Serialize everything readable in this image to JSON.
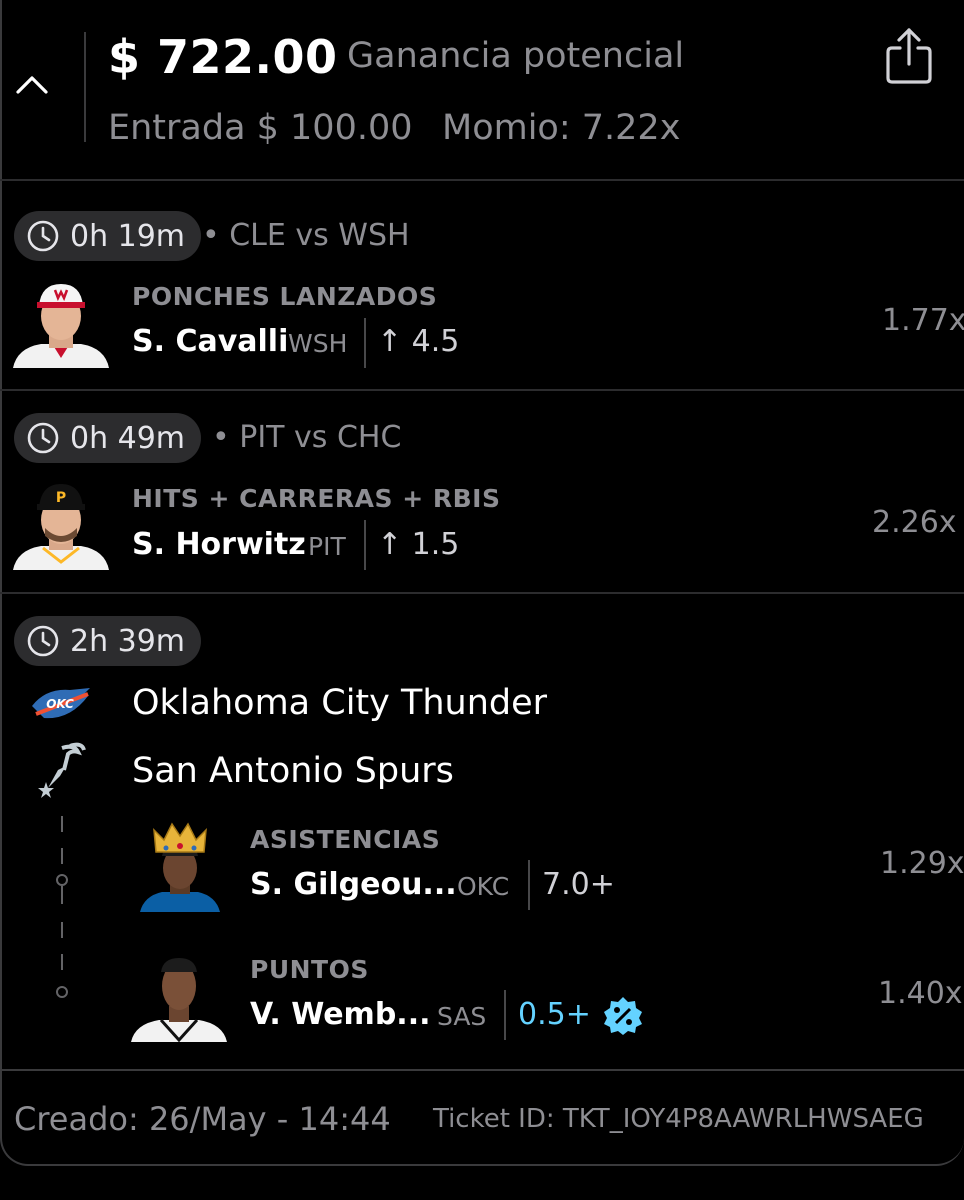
{
  "header": {
    "payout": "$ 722.00",
    "payout_label": "Ganancia potencial",
    "entry": "Entrada $ 100.00",
    "odds": "Momio: 7.22x"
  },
  "legs": [
    {
      "time": "0h 19m",
      "match": "• CLE vs WSH",
      "stat": "PONCHES LANZADOS",
      "player": "S. Cavalli",
      "team": "WSH",
      "line": "↑ 4.5",
      "multiplier": "1.77x"
    },
    {
      "time": "0h 49m",
      "match": "• PIT vs CHC",
      "stat": "HITS + CARRERAS + RBIS",
      "player": "S. Horwitz",
      "team": "PIT",
      "line": "↑ 1.5",
      "multiplier": "2.26x"
    }
  ],
  "game": {
    "time": "2h 39m",
    "team1": "Oklahoma City Thunder",
    "team2": "San Antonio Spurs",
    "team1_logo_text": "OKC",
    "props": [
      {
        "stat": "ASISTENCIAS",
        "player": "S. Gilgeou...",
        "team": "OKC",
        "line": "7.0+",
        "multiplier": "1.29x"
      },
      {
        "stat": "PUNTOS",
        "player": "V. Wemb...",
        "team": "SAS",
        "line": "0.5+",
        "multiplier": "1.40x"
      }
    ]
  },
  "footer": {
    "created": "Creado: 26/May - 14:44",
    "ticket": "Ticket ID: TKT_IOY4P8AAWRLHWSAEG"
  },
  "colors": {
    "background": "#000000",
    "pill": "#2c2c2e",
    "muted_text": "#8e8e93",
    "promo_blue": "#64d2ff"
  },
  "icons": [
    "chevron-up-icon",
    "share-icon",
    "clock-icon",
    "thunder-logo",
    "spurs-logo",
    "percent-badge-icon",
    "crown-icon"
  ]
}
